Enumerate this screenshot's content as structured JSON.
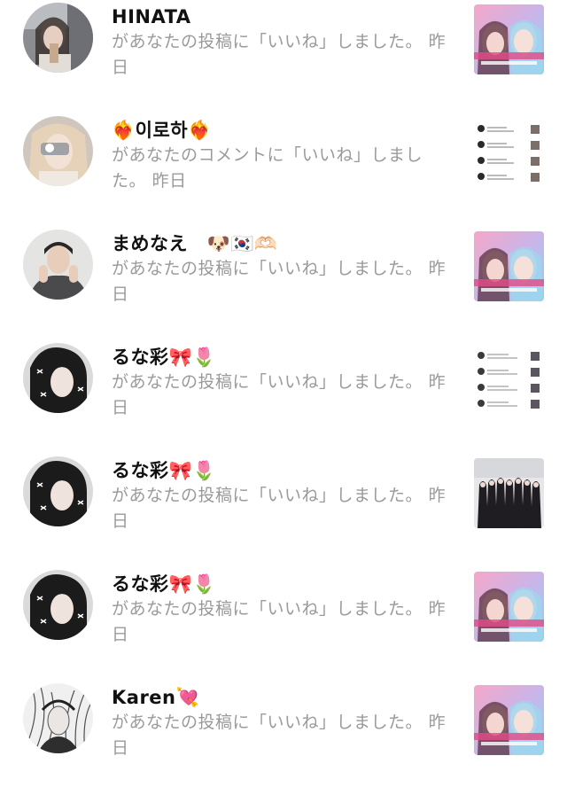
{
  "notifications": [
    {
      "name": "HINATA",
      "message": "があなたの投稿に「いいね」しました。",
      "time": "昨日",
      "avatar": "avatar-photo-woman",
      "thumbnail": "post-poster"
    },
    {
      "name": "❤️‍🔥이로하❤️‍🔥",
      "message": "があなたのコメントに「いいね」しました。",
      "time": "昨日",
      "avatar": "avatar-photo-mirror",
      "thumbnail": "comment-screenshot"
    },
    {
      "name": "まめなえ　🐶🇰🇷🫶🏻",
      "message": "があなたの投稿に「いいね」しました。",
      "time": "昨日",
      "avatar": "avatar-photo-man",
      "thumbnail": "post-poster"
    },
    {
      "name": "るな彩🎀🌷",
      "message": "があなたの投稿に「いいね」しました。",
      "time": "昨日",
      "avatar": "avatar-photo-dark-hair",
      "thumbnail": "comment-screenshot"
    },
    {
      "name": "るな彩🎀🌷",
      "message": "があなたの投稿に「いいね」しました。",
      "time": "昨日",
      "avatar": "avatar-photo-dark-hair",
      "thumbnail": "group-photo"
    },
    {
      "name": "るな彩🎀🌷",
      "message": "があなたの投稿に「いいね」しました。",
      "time": "昨日",
      "avatar": "avatar-photo-dark-hair",
      "thumbnail": "post-poster"
    },
    {
      "name": "Karen💘",
      "message": "があなたの投稿に「いいね」しました。",
      "time": "昨日",
      "avatar": "avatar-photo-monochrome",
      "thumbnail": "post-poster"
    }
  ],
  "colors": {
    "name_text": "#111111",
    "message_text": "#9a9a9a",
    "background": "#ffffff"
  }
}
